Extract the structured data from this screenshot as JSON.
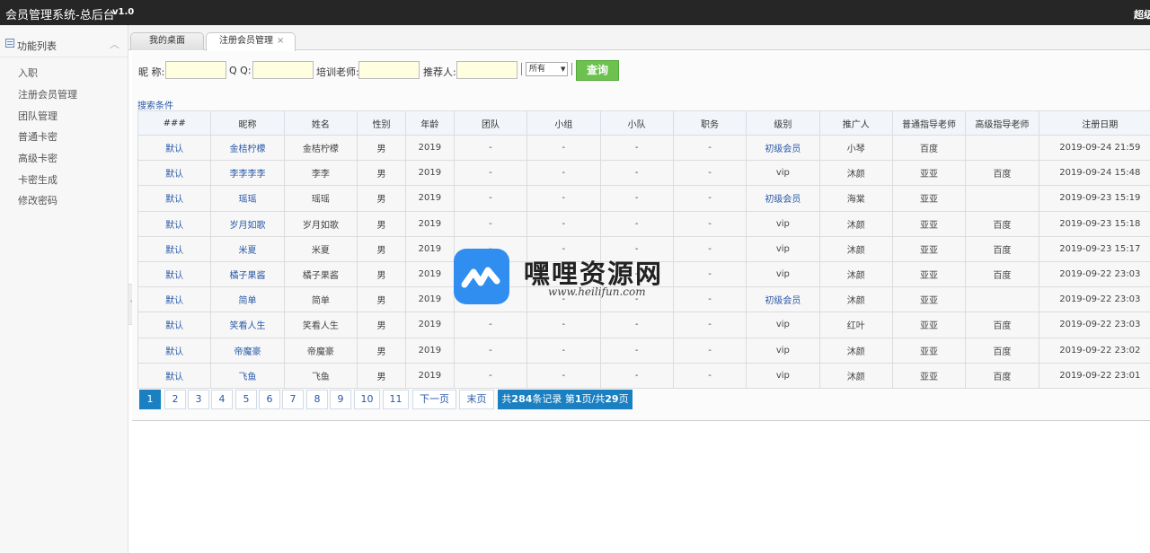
{
  "topbar": {
    "title": "会员管理系统-总后台",
    "version": "v1.0",
    "user": "超级"
  },
  "sidebar": {
    "title": "功能列表",
    "items": [
      "入职",
      "注册会员管理",
      "团队管理",
      "普通卡密",
      "高级卡密",
      "卡密生成",
      "修改密码"
    ]
  },
  "tabs": [
    {
      "label": "我的桌面"
    },
    {
      "label": "注册会员管理",
      "close": "×"
    }
  ],
  "search": {
    "nickname_label": "昵 称:",
    "qq_label": "Q Q:",
    "trainer_label": "培训老师:",
    "referrer_label": "推荐人:",
    "select_value": "所有",
    "query_button": "查询",
    "conditions_link": "搜索条件"
  },
  "table": {
    "headers": [
      "###",
      "昵称",
      "姓名",
      "性别",
      "年龄",
      "团队",
      "小组",
      "小队",
      "职务",
      "级别",
      "推广人",
      "普通指导老师",
      "高级指导老师",
      "注册日期"
    ],
    "rows": [
      [
        "默认",
        "金桔柠檬",
        "金桔柠檬",
        "男",
        "2019",
        "-",
        "-",
        "-",
        "-",
        "初级会员",
        "小琴",
        "百度",
        "",
        "2019-09-24 21:59"
      ],
      [
        "默认",
        "李李李李",
        "李李",
        "男",
        "2019",
        "-",
        "-",
        "-",
        "-",
        "vip",
        "沐颜",
        "亚亚",
        "百度",
        "2019-09-24 15:48"
      ],
      [
        "默认",
        "瑶瑶",
        "瑶瑶",
        "男",
        "2019",
        "-",
        "-",
        "-",
        "-",
        "初级会员",
        "海棠",
        "亚亚",
        "",
        "2019-09-23 15:19"
      ],
      [
        "默认",
        "岁月如歌",
        "岁月如歌",
        "男",
        "2019",
        "-",
        "-",
        "-",
        "-",
        "vip",
        "沐颜",
        "亚亚",
        "百度",
        "2019-09-23 15:18"
      ],
      [
        "默认",
        "米夏",
        "米夏",
        "男",
        "2019",
        "-",
        "-",
        "-",
        "-",
        "vip",
        "沐颜",
        "亚亚",
        "百度",
        "2019-09-23 15:17"
      ],
      [
        "默认",
        "橘子果酱",
        "橘子果酱",
        "男",
        "2019",
        "-",
        "-",
        "-",
        "-",
        "vip",
        "沐颜",
        "亚亚",
        "百度",
        "2019-09-22 23:03"
      ],
      [
        "默认",
        "简单",
        "简单",
        "男",
        "2019",
        "-",
        "-",
        "-",
        "-",
        "初级会员",
        "沐颜",
        "亚亚",
        "",
        "2019-09-22 23:03"
      ],
      [
        "默认",
        "笑看人生",
        "笑看人生",
        "男",
        "2019",
        "-",
        "-",
        "-",
        "-",
        "vip",
        "红叶",
        "亚亚",
        "百度",
        "2019-09-22 23:03"
      ],
      [
        "默认",
        "帝魔豪",
        "帝魔豪",
        "男",
        "2019",
        "-",
        "-",
        "-",
        "-",
        "vip",
        "沐颜",
        "亚亚",
        "百度",
        "2019-09-22 23:02"
      ],
      [
        "默认",
        "飞鱼",
        "飞鱼",
        "男",
        "2019",
        "-",
        "-",
        "-",
        "-",
        "vip",
        "沐颜",
        "亚亚",
        "百度",
        "2019-09-22 23:01"
      ]
    ]
  },
  "pager": {
    "pages": [
      "1",
      "2",
      "3",
      "4",
      "5",
      "6",
      "7",
      "8",
      "9",
      "10",
      "11"
    ],
    "current": "1",
    "next": "下一页",
    "last": "末页",
    "info_prefix": "共",
    "total": "284",
    "info_mid": "条记录 第",
    "page": "1",
    "info_sep": "页/共",
    "pages_total": "29",
    "info_suffix": "页"
  },
  "watermark": {
    "title": "嘿哩资源网",
    "url": "www.heilifun.com"
  },
  "colors": {
    "topbar": "#262626",
    "accent": "#1a80c2",
    "query": "#6cc14f",
    "link": "#2a5aa8",
    "input_bg": "#ffffe0"
  }
}
